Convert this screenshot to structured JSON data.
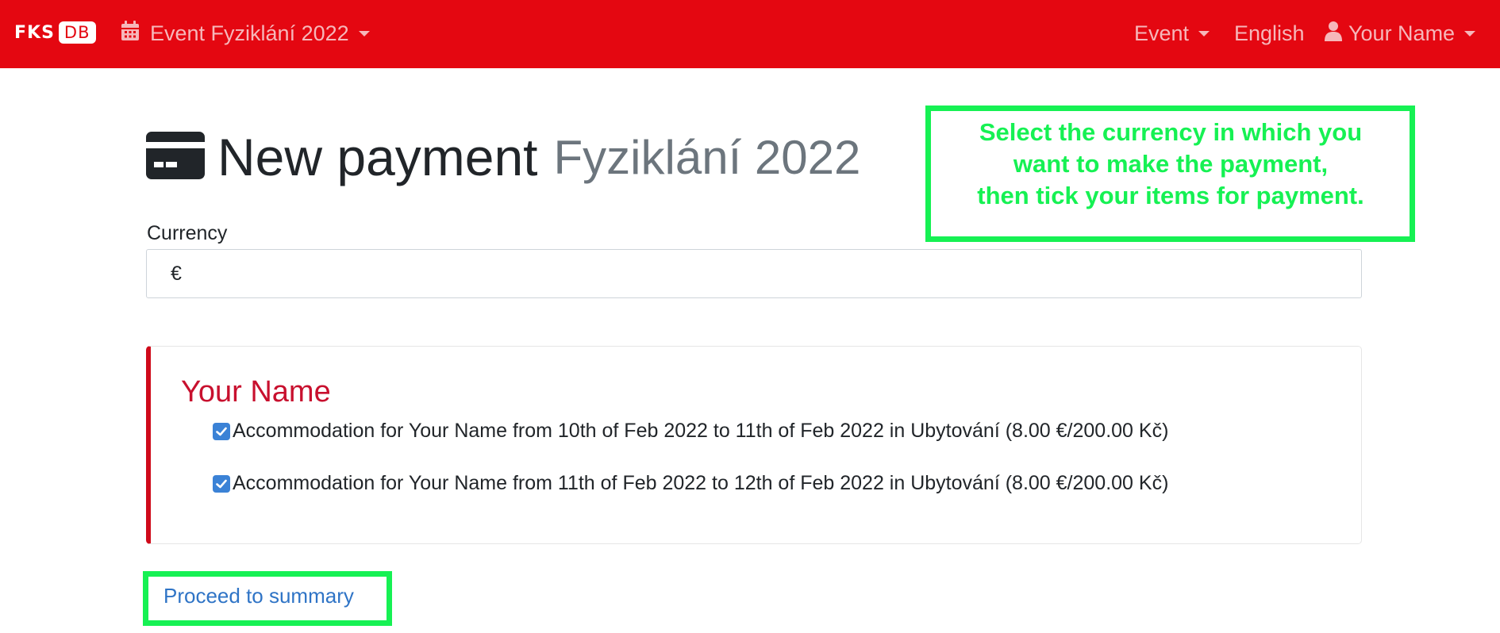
{
  "navbar": {
    "logo_text": "FKS",
    "logo_badge": "DB",
    "event_selector": "Event Fyziklání 2022",
    "event_menu": "Event",
    "language": "English",
    "user_menu": "Your Name"
  },
  "page": {
    "title": "New payment",
    "subtitle": "Fyziklání 2022"
  },
  "form": {
    "currency_label": "Currency",
    "currency_value": "€"
  },
  "person": {
    "name": "Your Name",
    "items": [
      {
        "label": "Accommodation for Your Name from 10th of Feb 2022 to 11th of Feb 2022 in Ubytování (8.00 €/200.00 Kč)",
        "checked": true
      },
      {
        "label": "Accommodation for Your Name from 11th of Feb 2022 to 12th of Feb 2022 in Ubytování (8.00 €/200.00 Kč)",
        "checked": true
      }
    ]
  },
  "actions": {
    "proceed": "Proceed to summary"
  },
  "annotation": {
    "line1": "Select the currency in which you",
    "line2": "want to make the payment,",
    "line3": "then tick your items for payment."
  },
  "colors": {
    "navbar": "#e40711",
    "annotation": "#16f153",
    "card_accent": "#cf0a1a",
    "link": "#2f74c6",
    "checkbox": "#3b82d6"
  }
}
